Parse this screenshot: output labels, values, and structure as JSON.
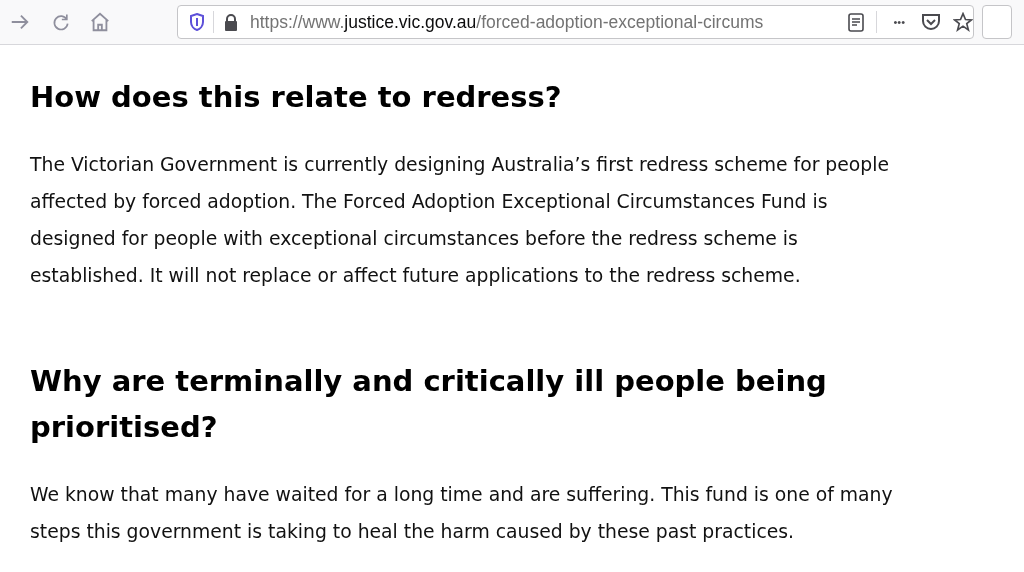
{
  "toolbar": {
    "url_prefix": "https://www.",
    "url_domain": "justice.vic.gov.au",
    "url_path": "/forced-adoption-exceptional-circums",
    "more": "•••"
  },
  "sections": [
    {
      "heading": [
        "How does this relate to redress?"
      ],
      "paragraph": [
        "The Victorian Government is currently designing Australia’s first redress scheme for people",
        "affected by forced adoption. The Forced Adoption Exceptional Circumstances Fund is",
        "designed for people with exceptional circumstances before the redress scheme is",
        "established. It will not replace or affect future applications to the redress scheme."
      ]
    },
    {
      "heading": [
        "Why are terminally and critically ill people being",
        "prioritised?"
      ],
      "paragraph": [
        "We know that many have waited for a long time and are suffering. This fund is one of many",
        "steps this government is taking to heal the harm caused by these past practices."
      ]
    }
  ]
}
